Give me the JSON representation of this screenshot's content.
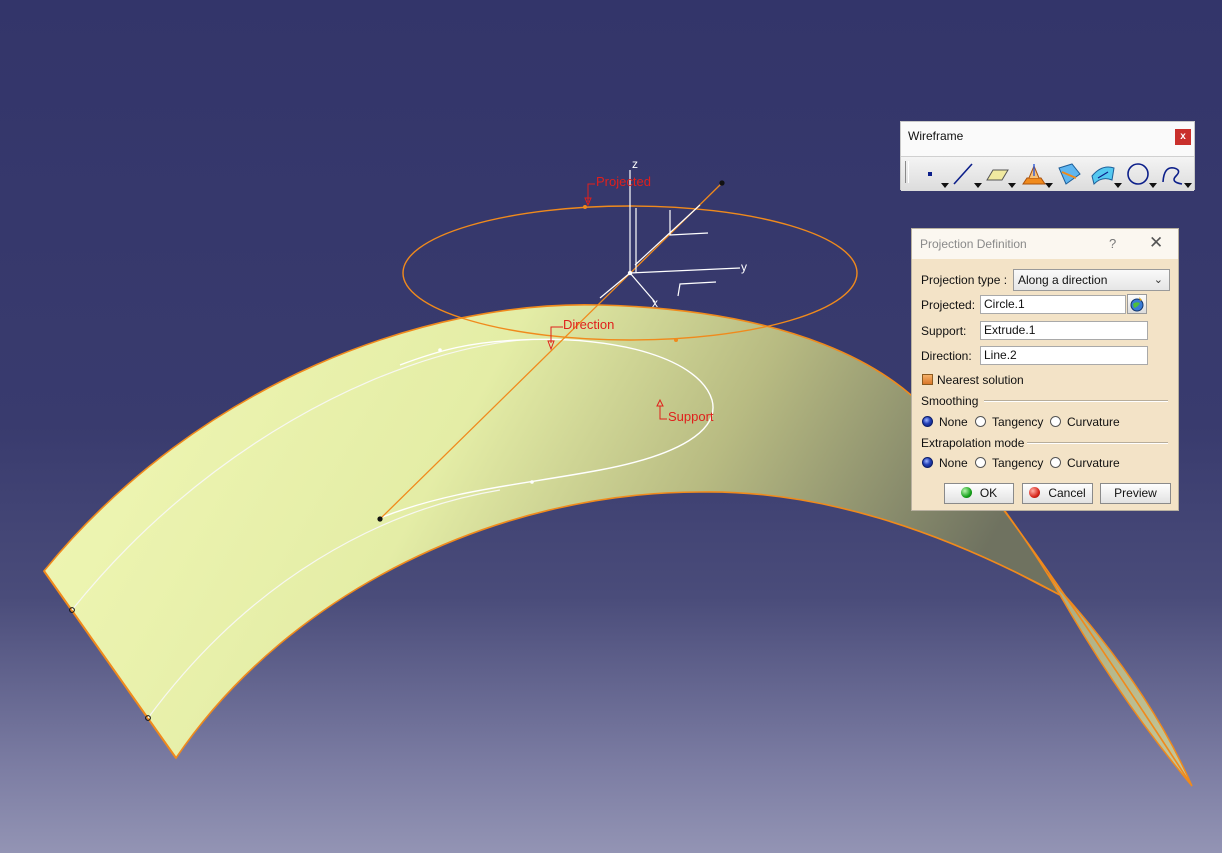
{
  "viewport": {
    "annotations": {
      "projected": "Projected",
      "direction": "Direction",
      "support": "Support"
    },
    "axes": {
      "x": "x",
      "y": "y",
      "z": "z"
    }
  },
  "toolbar": {
    "title": "Wireframe",
    "close": "x",
    "tools": [
      "point-icon",
      "line-icon",
      "plane-icon",
      "projection-icon",
      "intersection-icon",
      "offset-icon",
      "circle-icon",
      "spline-icon"
    ]
  },
  "dialog": {
    "title": "Projection Definition",
    "help": "?",
    "close": "✕",
    "projection_type_label": "Projection type :",
    "projection_type_value": "Along a direction",
    "projected_label": "Projected:",
    "projected_value": "Circle.1",
    "support_label": "Support:",
    "support_value": "Extrude.1",
    "direction_label": "Direction:",
    "direction_value": "Line.2",
    "nearest_label": "Nearest solution",
    "nearest_checked": true,
    "smoothing": {
      "label": "Smoothing",
      "options": [
        "None",
        "Tangency",
        "Curvature"
      ],
      "selected": "None"
    },
    "extrapolation": {
      "label": "Extrapolation mode",
      "options": [
        "None",
        "Tangency",
        "Curvature"
      ],
      "selected": "None"
    },
    "ok_label": "OK",
    "cancel_label": "Cancel",
    "preview_label": "Preview"
  },
  "colors": {
    "background_top": "#33356a",
    "surface": "#eef5b0",
    "edge": "#f08a1c",
    "annotation": "#e0201c",
    "dialog_bg": "#f3e3c7"
  }
}
